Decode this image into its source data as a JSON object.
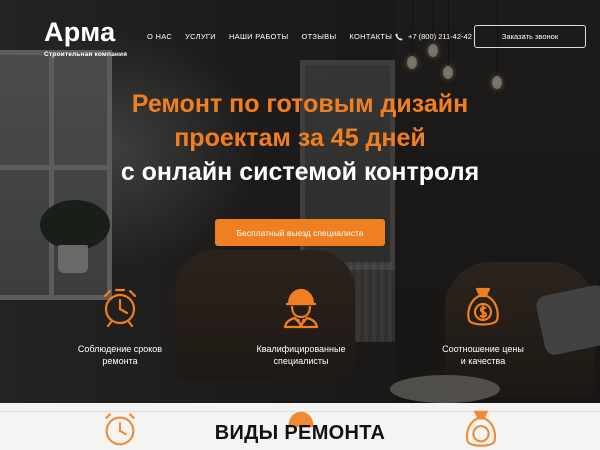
{
  "brand": {
    "name": "Арма",
    "tagline": "Строительная компания"
  },
  "nav": {
    "items": [
      "О НАС",
      "УСЛУГИ",
      "НАШИ РАБОТЫ",
      "ОТЗЫВЫ",
      "КОНТАКТЫ"
    ]
  },
  "header": {
    "phone": "+7 (800) 211-42-42",
    "callback_label": "Заказать звонок"
  },
  "hero": {
    "line1": "Ремонт по готовым дизайн",
    "line2": "проектам за 45 дней",
    "line3": "с онлайн системой контроля",
    "cta_label": "Бесплатный выезд специалиста"
  },
  "features": [
    {
      "icon": "alarm-clock-icon",
      "text": "Соблюдение сроков\nремонта"
    },
    {
      "icon": "worker-helmet-icon",
      "text": "Квалифицированные\nспециалисты"
    },
    {
      "icon": "money-bag-icon",
      "text": "Соотношение цены\nи качества"
    }
  ],
  "section": {
    "title": "ВИДЫ РЕМОНТА"
  },
  "colors": {
    "accent": "#f07f21",
    "text_light": "#ffffff",
    "section_bg": "#f4f4f2"
  }
}
